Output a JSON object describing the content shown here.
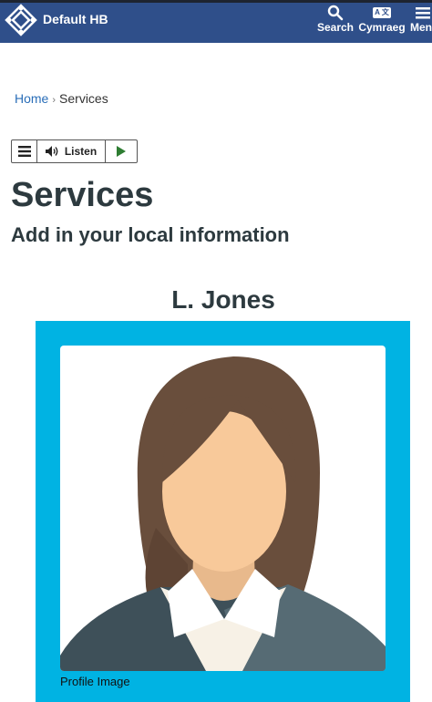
{
  "header": {
    "brand": "Default HB",
    "nav": {
      "search": "Search",
      "cymraeg": "Cymraeg",
      "menu": "Menu",
      "cymraeg_badge": "A 文"
    }
  },
  "breadcrumb": {
    "home": "Home",
    "separator": "›",
    "current": "Services"
  },
  "readspeaker": {
    "listen_label": "Listen"
  },
  "page": {
    "title": "Services",
    "subtitle": "Add in your local information"
  },
  "profile": {
    "name": "L. Jones",
    "caption": "Profile Image"
  },
  "colors": {
    "header_bg": "#2f4f8a",
    "card_bg": "#00b3e3",
    "link": "#2a6eb8"
  }
}
